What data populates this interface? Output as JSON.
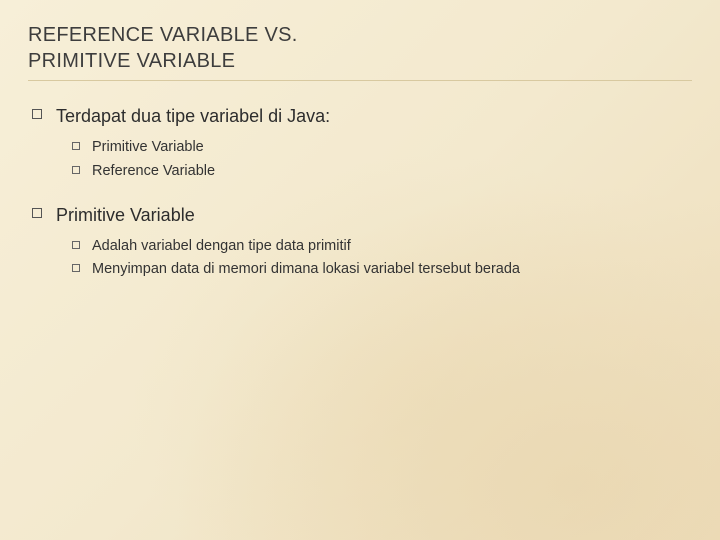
{
  "title_line1": "REFERENCE VARIABLE VS.",
  "title_line2": "PRIMITIVE VARIABLE",
  "sections": [
    {
      "heading": "Terdapat dua tipe variabel di Java:",
      "items": [
        "Primitive Variable",
        "Reference Variable"
      ]
    },
    {
      "heading": "Primitive Variable",
      "items": [
        "Adalah variabel dengan tipe data primitif",
        "Menyimpan data di memori dimana lokasi variabel tersebut berada"
      ]
    }
  ]
}
